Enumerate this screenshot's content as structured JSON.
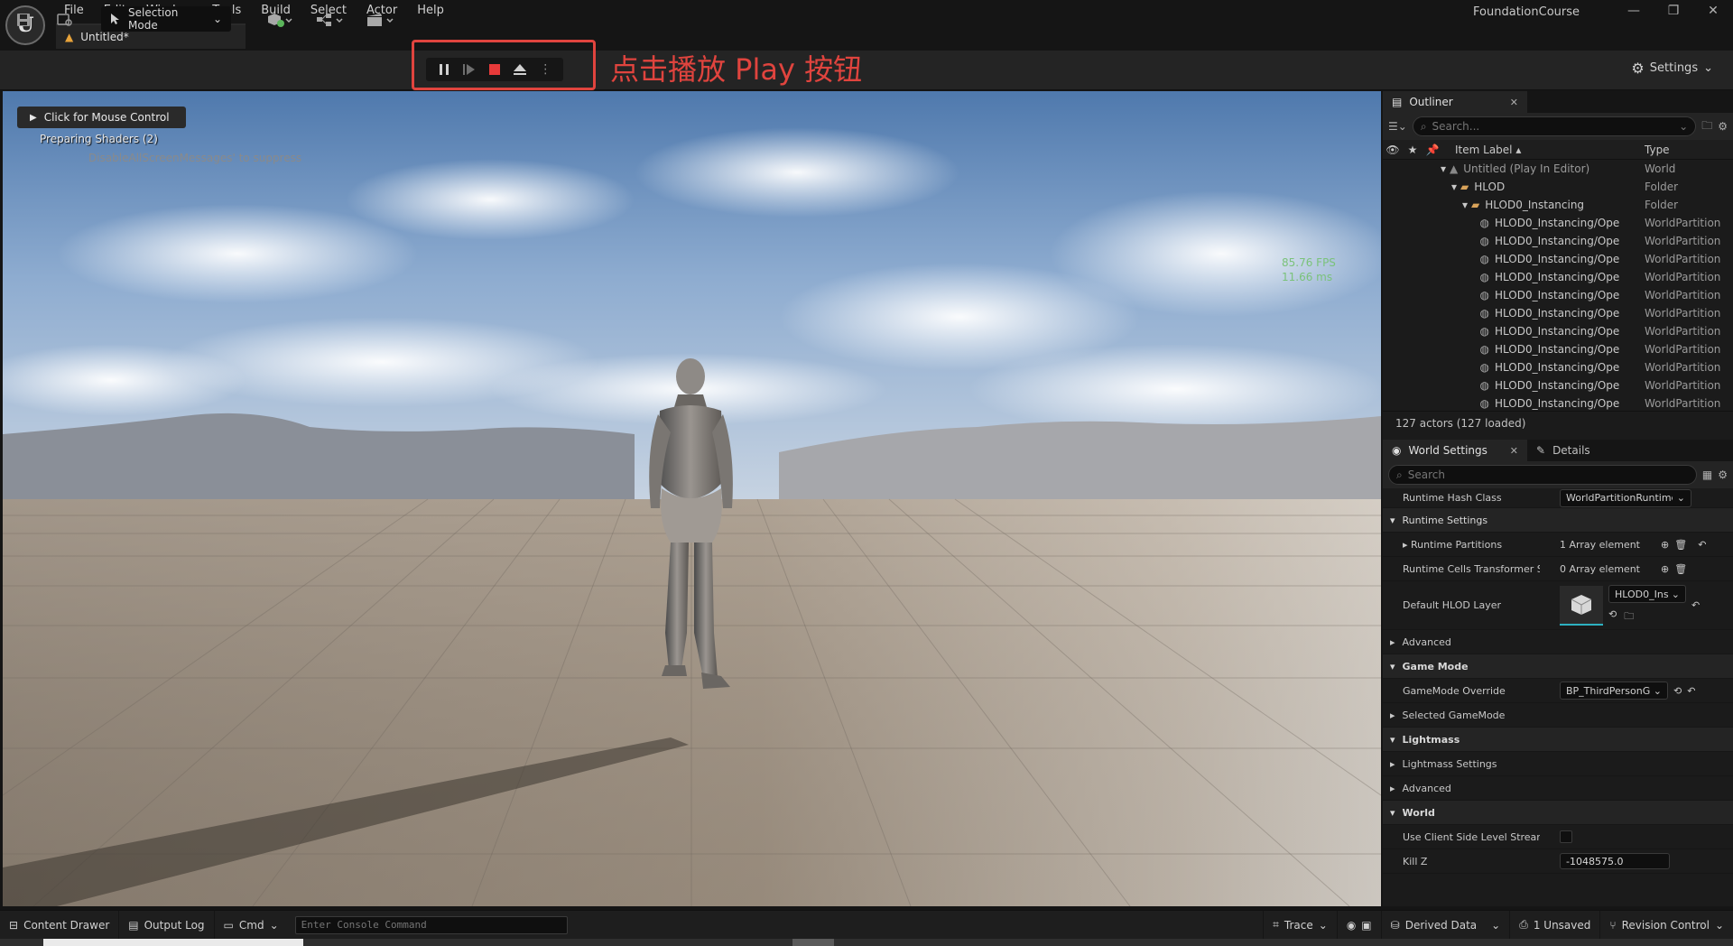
{
  "app": {
    "project_name": "FoundationCourse",
    "tab_title": "Untitled*",
    "menu": [
      "File",
      "Edit",
      "Window",
      "Tools",
      "Build",
      "Select",
      "Actor",
      "Help"
    ]
  },
  "toolbar": {
    "mode_label": "Selection Mode",
    "settings_label": "Settings",
    "annotation": "点击播放 Play 按钮"
  },
  "viewport": {
    "mouse_control": "Click for Mouse Control",
    "shaders": "Preparing Shaders (2)",
    "suppress": "DisableAllScreenMessages' to suppress",
    "fps": "85.76 FPS",
    "ms": "11.66 ms"
  },
  "outliner": {
    "tab": "Outliner",
    "search_placeholder": "Search...",
    "col_label": "Item Label",
    "col_type": "Type",
    "rows": [
      {
        "label": "Untitled (Play In Editor)",
        "type": "World"
      },
      {
        "label": "HLOD",
        "type": "Folder"
      },
      {
        "label": "HLOD0_Instancing",
        "type": "Folder"
      },
      {
        "label": "HLOD0_Instancing/Ope",
        "type": "WorldPartition"
      },
      {
        "label": "HLOD0_Instancing/Ope",
        "type": "WorldPartition"
      },
      {
        "label": "HLOD0_Instancing/Ope",
        "type": "WorldPartition"
      },
      {
        "label": "HLOD0_Instancing/Ope",
        "type": "WorldPartition"
      },
      {
        "label": "HLOD0_Instancing/Ope",
        "type": "WorldPartition"
      },
      {
        "label": "HLOD0_Instancing/Ope",
        "type": "WorldPartition"
      },
      {
        "label": "HLOD0_Instancing/Ope",
        "type": "WorldPartition"
      },
      {
        "label": "HLOD0_Instancing/Ope",
        "type": "WorldPartition"
      },
      {
        "label": "HLOD0_Instancing/Ope",
        "type": "WorldPartition"
      },
      {
        "label": "HLOD0_Instancing/Ope",
        "type": "WorldPartition"
      },
      {
        "label": "HLOD0_Instancing/Ope",
        "type": "WorldPartition"
      }
    ],
    "status": "127 actors (127 loaded)"
  },
  "details": {
    "tab_world": "World Settings",
    "tab_details": "Details",
    "search_placeholder": "Search",
    "runtime_hash_class": "Runtime Hash Class",
    "runtime_hash_value": "WorldPartitionRuntime",
    "cat_runtime_settings": "Runtime Settings",
    "runtime_partitions": "Runtime Partitions",
    "runtime_partitions_value": "1 Array element",
    "runtime_cells": "Runtime Cells Transformer St...",
    "runtime_cells_value": "0 Array element",
    "default_hlod": "Default HLOD Layer",
    "default_hlod_value": "HLOD0_Ins",
    "advanced1": "Advanced",
    "cat_game_mode": "Game Mode",
    "gamemode_override": "GameMode Override",
    "gamemode_value": "BP_ThirdPersonG",
    "selected_gamemode": "Selected GameMode",
    "cat_lightmass": "Lightmass",
    "lightmass_settings": "Lightmass Settings",
    "advanced2": "Advanced",
    "cat_world": "World",
    "use_client_side": "Use Client Side Level Streami...",
    "kill_z": "Kill Z",
    "kill_z_value": "-1048575.0"
  },
  "statusbar": {
    "content_drawer": "Content Drawer",
    "output_log": "Output Log",
    "cmd": "Cmd",
    "console_placeholder": "Enter Console Command",
    "trace": "Trace",
    "derived_data": "Derived Data",
    "unsaved": "1 Unsaved",
    "revision_control": "Revision Control"
  }
}
